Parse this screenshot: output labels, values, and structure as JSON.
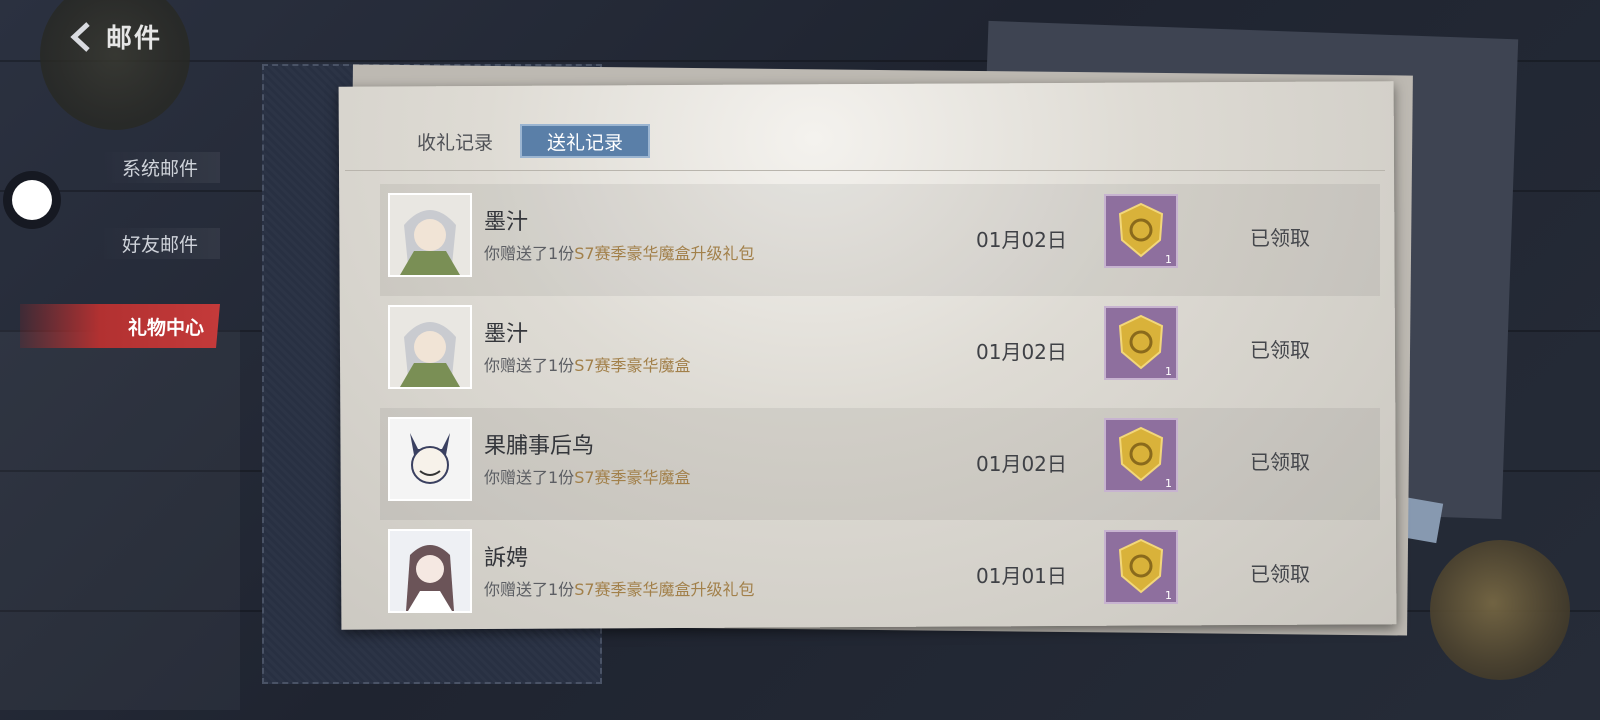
{
  "header": {
    "title": "邮件"
  },
  "sidebar": {
    "items": [
      {
        "label": "系统邮件"
      },
      {
        "label": "好友邮件"
      },
      {
        "label": "礼物中心"
      }
    ]
  },
  "tabs": [
    {
      "label": "收礼记录"
    },
    {
      "label": "送礼记录"
    }
  ],
  "records": [
    {
      "name": "墨汁",
      "msg_prefix": "你赠送了1份",
      "gift": "S7赛季豪华魔盒升级礼包",
      "date": "01月02日",
      "count": "1",
      "status": "已领取"
    },
    {
      "name": "墨汁",
      "msg_prefix": "你赠送了1份",
      "gift": "S7赛季豪华魔盒",
      "date": "01月02日",
      "count": "1",
      "status": "已领取"
    },
    {
      "name": "果脯事后鸟",
      "msg_prefix": "你赠送了1份",
      "gift": "S7赛季豪华魔盒",
      "date": "01月02日",
      "count": "1",
      "status": "已领取"
    },
    {
      "name": "訴娉",
      "msg_prefix": "你赠送了1份",
      "gift": "S7赛季豪华魔盒升级礼包",
      "date": "01月01日",
      "count": "1",
      "status": "已领取"
    }
  ],
  "colors": {
    "active_tab": "#5a7fa8",
    "active_menu": "#c43a3a",
    "gift_text": "#a2804a",
    "item_bg": "#8e6f9e"
  }
}
